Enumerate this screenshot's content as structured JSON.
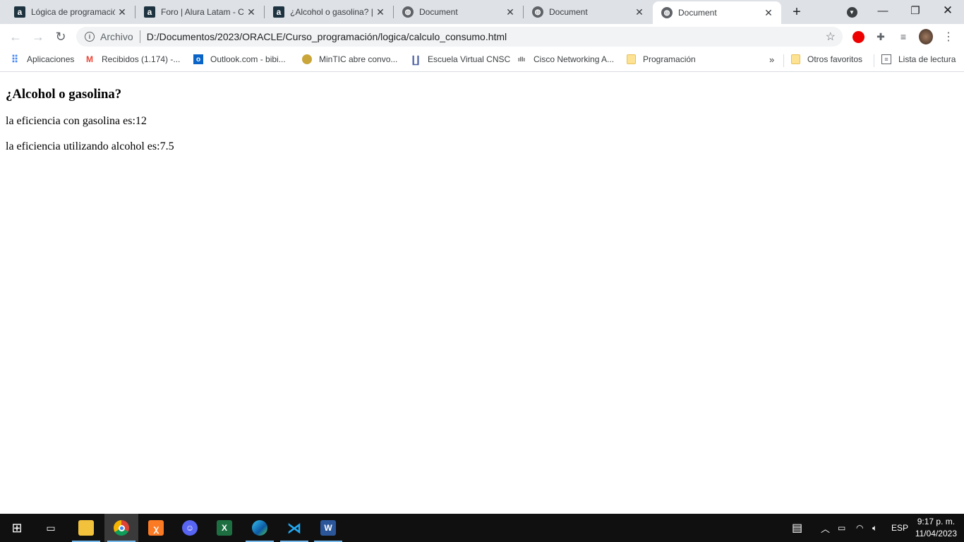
{
  "browser": {
    "tabs": [
      {
        "title": "Lógica de programació",
        "favicon": "alura-icon"
      },
      {
        "title": "Foro | Alura Latam - Cu",
        "favicon": "alura-icon"
      },
      {
        "title": "¿Alcohol o gasolina? |",
        "favicon": "alura-icon"
      },
      {
        "title": "Document",
        "favicon": "globe-icon"
      },
      {
        "title": "Document",
        "favicon": "globe-icon"
      },
      {
        "title": "Document",
        "favicon": "globe-icon",
        "active": true
      }
    ],
    "new_tab": "+",
    "omnibox": {
      "chip": "Archivo",
      "url": "D:/Documentos/2023/ORACLE/Curso_programación/logica/calculo_consumo.html"
    },
    "bookmarks": [
      {
        "label": "Aplicaciones",
        "icon": "apps-grid-icon"
      },
      {
        "label": "Recibidos (1.174) -...",
        "icon": "gmail-icon"
      },
      {
        "label": "Outlook.com - bibi...",
        "icon": "outlook-icon"
      },
      {
        "label": "MinTIC abre convo...",
        "icon": "mintic-icon"
      },
      {
        "label": "Escuela Virtual CNSC",
        "icon": "cnsc-icon"
      },
      {
        "label": "Cisco Networking A...",
        "icon": "cisco-icon"
      },
      {
        "label": "Programación",
        "icon": "folder-icon"
      }
    ],
    "overflow": "»",
    "other_bookmarks": "Otros favoritos",
    "reading_list": "Lista de lectura"
  },
  "page": {
    "heading": "¿Alcohol o gasolina?",
    "lines": [
      "la eficiencia con gasolina es:12",
      "la eficiencia utilizando alcohol es:7.5"
    ]
  },
  "taskbar": {
    "language": "ESP",
    "time": "9:17 p. m.",
    "date": "11/04/2023"
  }
}
